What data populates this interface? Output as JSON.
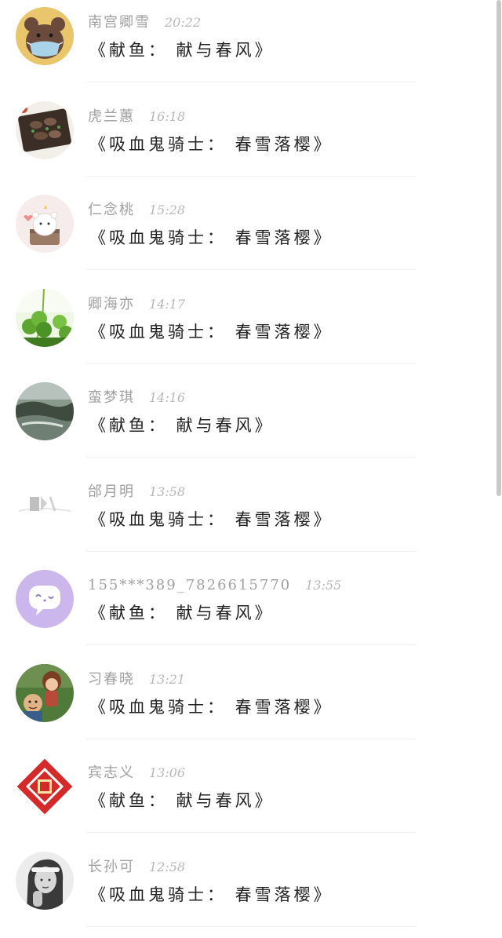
{
  "messages": [
    {
      "name": "南宫卿雪",
      "time": "20:22",
      "text": "《献鱼： 献与春风》",
      "avatar_icon": "bear-mask-avatar"
    },
    {
      "name": "虎兰蕙",
      "time": "16:18",
      "text": "《吸血鬼骑士： 春雪落樱》",
      "avatar_icon": "food-photo-avatar"
    },
    {
      "name": "仁念桃",
      "time": "15:28",
      "text": "《吸血鬼骑士： 春雪落樱》",
      "avatar_icon": "cartoon-bear-avatar"
    },
    {
      "name": "卿海亦",
      "time": "14:17",
      "text": "《吸血鬼骑士： 春雪落樱》",
      "avatar_icon": "clover-avatar"
    },
    {
      "name": "蛮梦琪",
      "time": "14:16",
      "text": "《献鱼： 献与春风》",
      "avatar_icon": "landscape-avatar"
    },
    {
      "name": "邰月明",
      "time": "13:58",
      "text": "《吸血鬼骑士： 春雪落樱》",
      "avatar_icon": "sketch-avatar"
    },
    {
      "name": "155***389_7826615770",
      "time": "13:55",
      "text": "《献鱼： 献与春风》",
      "avatar_icon": "chat-bubble-avatar"
    },
    {
      "name": "习春晓",
      "time": "13:21",
      "text": "《吸血鬼骑士： 春雪落樱》",
      "avatar_icon": "cartoon-characters-avatar"
    },
    {
      "name": "宾志义",
      "time": "13:06",
      "text": "《献鱼： 献与春风》",
      "avatar_icon": "fu-papercut-avatar"
    },
    {
      "name": "长孙可",
      "time": "12:58",
      "text": "《吸血鬼骑士： 春雪落樱》",
      "avatar_icon": "girl-photo-avatar"
    }
  ],
  "colors": {
    "name": "#a0a0a0",
    "time": "#b8b8b8",
    "message": "#222222",
    "divider": "#f0f0f0",
    "scrollbar": "#c9c9c9"
  }
}
